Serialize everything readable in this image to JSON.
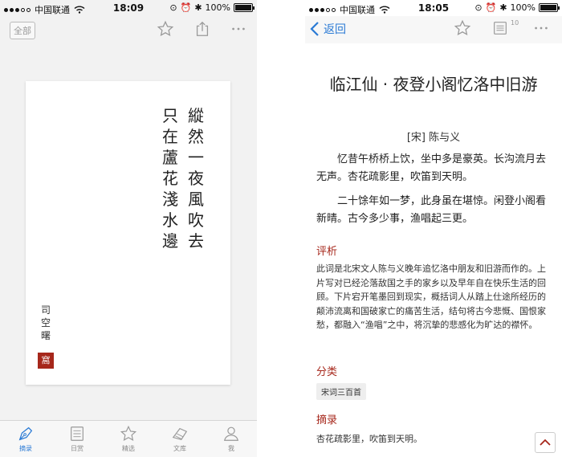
{
  "colors": {
    "accent": "#2a7ad5",
    "seal": "#a6271b",
    "section": "#a6271b"
  },
  "left_phone": {
    "status": {
      "carrier": "中国联通",
      "time": "18:09",
      "battery": "100%",
      "battery_level": 1.0
    },
    "nav": {
      "all_label": "全部",
      "icons": [
        "star-icon",
        "share-icon",
        "more-icon"
      ]
    },
    "card": {
      "poem_columns": [
        "縱然一夜風吹去",
        "只在蘆花淺水邊"
      ],
      "author": "司空曙",
      "seal": "窩"
    },
    "tabbar": {
      "items": [
        {
          "label": "摘录",
          "icon": "pen-nib-icon",
          "active": true
        },
        {
          "label": "日赏",
          "icon": "calendar-icon",
          "active": false
        },
        {
          "label": "精选",
          "icon": "star-icon",
          "active": false
        },
        {
          "label": "文库",
          "icon": "book-icon",
          "active": false
        },
        {
          "label": "我",
          "icon": "person-icon",
          "active": false
        }
      ]
    }
  },
  "right_phone": {
    "status": {
      "carrier": "中国联通",
      "time": "18:05",
      "battery": "100%",
      "battery_level": 1.0
    },
    "nav": {
      "back_label": "返回",
      "badge": "10",
      "icons": [
        "star-icon",
        "list-icon",
        "more-icon"
      ]
    },
    "title": "临江仙 · 夜登小阁忆洛中旧游",
    "author": "[宋] 陈与义",
    "poem": [
      "忆昔午桥桥上饮，坐中多是豪英。长沟流月去无声。杏花疏影里，吹笛到天明。",
      "二十馀年如一梦，此身虽在堪惊。闲登小阁看新晴。古今多少事，渔唱起三更。"
    ],
    "analysis_heading": "评析",
    "analysis": "此词是北宋文人陈与义晚年追忆洛中朋友和旧游而作的。上片写对已经沦落敌国之手的家乡以及早年自在快乐生活的回顾。下片宕开笔墨回到现实，概括词人从踏上仕途所经历的颠沛流离和国破家亡的痛苦生活，结句将古今悲慨、国恨家愁，都融入“渔唱”之中，将沉挚的悲感化为旷达的襟怀。",
    "category_heading": "分类",
    "category_tag": "宋词三百首",
    "excerpt_heading": "摘录",
    "excerpt": "杏花疏影里，吹笛到天明。"
  }
}
